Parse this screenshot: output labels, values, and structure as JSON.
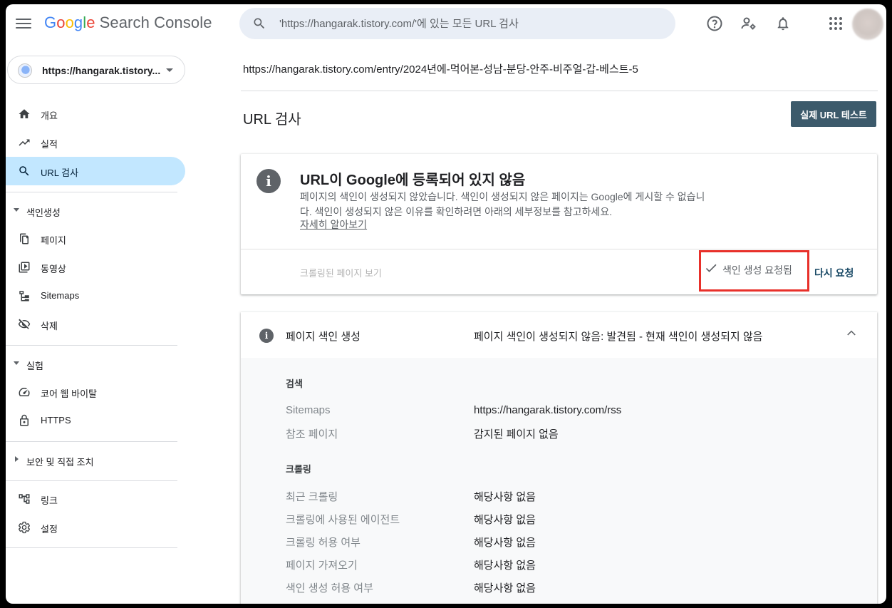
{
  "header": {
    "logo_google": [
      "G",
      "o",
      "o",
      "g",
      "l",
      "e"
    ],
    "logo_product": "Search Console",
    "search_placeholder": "'https://hangarak.tistory.com/'에 있는 모든 URL 검사",
    "icons": [
      "help-icon",
      "manage-users-icon",
      "notifications-icon",
      "apps-icon"
    ]
  },
  "sidebar": {
    "property": "https://hangarak.tistory...",
    "items_top": [
      {
        "label": "개요",
        "icon": "home-icon"
      },
      {
        "label": "실적",
        "icon": "trending-icon"
      },
      {
        "label": "URL 검사",
        "icon": "search-icon",
        "active": true
      }
    ],
    "section_indexing": {
      "label": "색인생성",
      "items": [
        {
          "label": "페이지",
          "icon": "pages-icon"
        },
        {
          "label": "동영상",
          "icon": "video-icon"
        },
        {
          "label": "Sitemaps",
          "icon": "sitemap-icon"
        },
        {
          "label": "삭제",
          "icon": "removal-icon"
        }
      ]
    },
    "section_experience": {
      "label": "실험",
      "items": [
        {
          "label": "코어 웹 바이탈",
          "icon": "speed-icon"
        },
        {
          "label": "HTTPS",
          "icon": "lock-icon"
        }
      ]
    },
    "section_security": {
      "label": "보안 및 직접 조치"
    },
    "items_bottom": [
      {
        "label": "링크",
        "icon": "links-icon"
      },
      {
        "label": "설정",
        "icon": "settings-icon"
      }
    ]
  },
  "main": {
    "inspected_url": "https://hangarak.tistory.com/entry/2024년에-먹어본-성남-분당-안주-비주얼-갑-베스트-5",
    "page_title": "URL 검사",
    "live_test_button": "실제 URL 테스트",
    "status_card": {
      "title": "URL이 Google에 등록되어 있지 않음",
      "description": "페이지의 색인이 생성되지 않았습니다. 색인이 생성되지 않은 페이지는 Google에 게시할 수 없습니다. 색인이 생성되지 않은 이유를 확인하려면 아래의 세부정보를 참고하세요.",
      "learn_more": "자세히 알아보기",
      "view_crawled": "크롤링된 페이지 보기",
      "indexing_requested": "색인 생성 요청됨",
      "request_again": "다시 요청",
      "highlight_color": "#e8302a"
    },
    "indexing_panel": {
      "title": "페이지 색인 생성",
      "status": "페이지 색인이 생성되지 않음: 발견됨 - 현재 색인이 생성되지 않음",
      "discovery_heading": "검색",
      "discovery_rows": [
        {
          "label": "Sitemaps",
          "value": "https://hangarak.tistory.com/rss"
        },
        {
          "label": "참조 페이지",
          "value": "감지된 페이지 없음"
        }
      ],
      "crawl_heading": "크롤링",
      "crawl_rows": [
        {
          "label": "최근 크롤링",
          "value": "해당사항 없음"
        },
        {
          "label": "크롤링에 사용된 에이전트",
          "value": "해당사항 없음"
        },
        {
          "label": "크롤링 허용 여부",
          "value": "해당사항 없음"
        },
        {
          "label": "페이지 가져오기",
          "value": "해당사항 없음"
        },
        {
          "label": "색인 생성 허용 여부",
          "value": "해당사항 없음"
        }
      ]
    }
  },
  "colors": {
    "active_nav": "#c2e7ff",
    "search_bg": "#e9eef6",
    "button_bg": "#3c5a6b"
  }
}
